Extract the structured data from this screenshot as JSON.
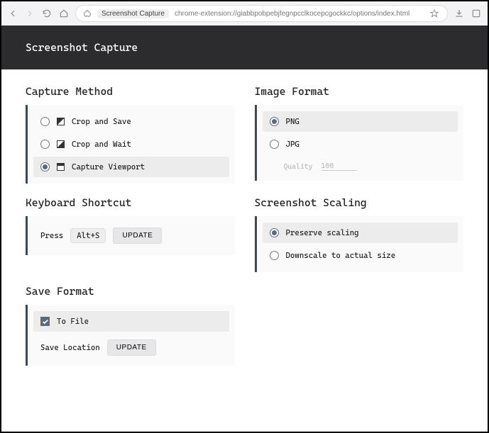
{
  "chrome": {
    "chip": "Screenshot Capture",
    "url": "chrome-extension://giabbpobpebjfegnpcclkocepcgockkc/options/index.html"
  },
  "header": {
    "title": "Screenshot Capture"
  },
  "captureMethod": {
    "title": "Capture Method",
    "options": [
      {
        "label": "Crop and Save"
      },
      {
        "label": "Crop and Wait"
      },
      {
        "label": "Capture Viewport"
      }
    ]
  },
  "keyboard": {
    "title": "Keyboard Shortcut",
    "press": "Press",
    "shortcut": "Alt+S",
    "update": "UPDATE"
  },
  "saveFormat": {
    "title": "Save Format",
    "toFile": "To File",
    "saveLocation": "Save Location",
    "update": "UPDATE"
  },
  "imageFormat": {
    "title": "Image Format",
    "png": "PNG",
    "jpg": "JPG",
    "qualityLabel": "Quality",
    "qualityValue": "100"
  },
  "scaling": {
    "title": "Screenshot Scaling",
    "preserve": "Preserve scaling",
    "downscale": "Downscale to actual size"
  }
}
